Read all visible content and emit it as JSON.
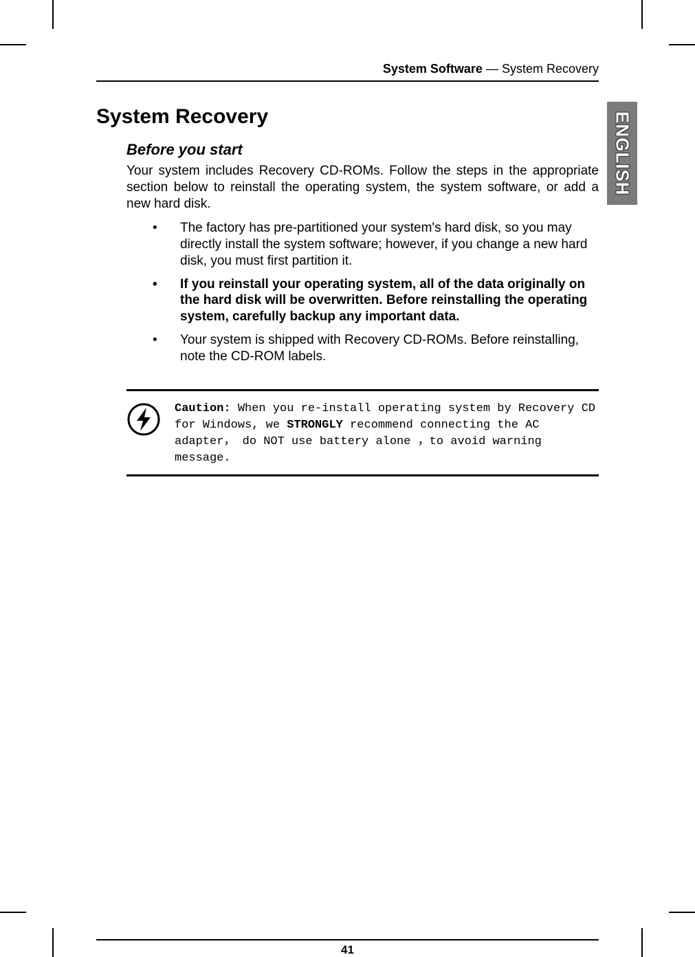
{
  "header": {
    "section_bold": "System Software",
    "section_rest": " — System Recovery"
  },
  "side_tab": "ENGLISH",
  "title": "System Recovery",
  "subtitle": "Before you start",
  "intro": "Your system includes Recovery CD-ROMs. Follow the steps in the appropriate section below to reinstall the operating system, the system software, or add a new hard disk.",
  "bullets": [
    {
      "text": "The factory has pre-partitioned your system's hard disk, so you may directly install the system software; however, if you change a new hard disk, you must first partition it.",
      "bold": false
    },
    {
      "text": "If you reinstall your operating system, all of the data originally on the hard disk will be overwritten. Before reinstalling the operating system, carefully backup any important data.",
      "bold": true
    },
    {
      "text": "Your system is shipped with Recovery CD-ROMs. Before reinstalling, note the CD-ROM labels.",
      "bold": false
    }
  ],
  "caution": {
    "label": "Caution:",
    "part1": " When you re-install operating system by Recovery CD for Windows, we ",
    "strong": "STRONGLY",
    "part2": " recommend connecting the AC adapter， do NOT use battery alone ，to avoid warning message."
  },
  "page_number": "41"
}
